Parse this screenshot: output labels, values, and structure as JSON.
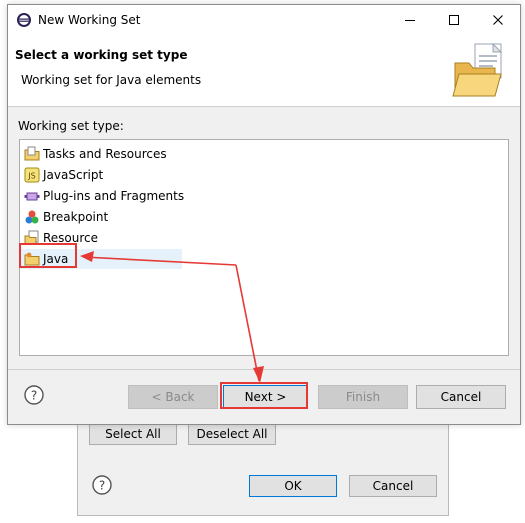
{
  "window": {
    "title": "New Working Set",
    "icon": "eclipse-icon",
    "controls": [
      "minimize-icon",
      "maximize-icon",
      "close-icon"
    ]
  },
  "banner": {
    "title": "Select a working set type",
    "subtitle": "Working set for Java elements",
    "image": "folder-document-icon"
  },
  "list": {
    "label": "Working set type:",
    "items": [
      {
        "label": "Tasks and Resources",
        "icon": "tasks-folder-icon"
      },
      {
        "label": "JavaScript",
        "icon": "javascript-icon"
      },
      {
        "label": "Plug-ins and Fragments",
        "icon": "plugin-icon"
      },
      {
        "label": "Breakpoint",
        "icon": "breakpoint-icon"
      },
      {
        "label": "Resource",
        "icon": "resource-folder-icon"
      },
      {
        "label": "Java",
        "icon": "java-folder-icon",
        "selected": true
      }
    ]
  },
  "buttons": {
    "back": "< Back",
    "next": "Next >",
    "finish": "Finish",
    "cancel": "Cancel"
  },
  "background_dialog": {
    "select_all": "Select All",
    "deselect_all": "Deselect All",
    "ok": "OK",
    "cancel": "Cancel"
  },
  "colors": {
    "annotation": "#e53935",
    "selection": "#e5f1fb",
    "focus": "#0078d7"
  }
}
